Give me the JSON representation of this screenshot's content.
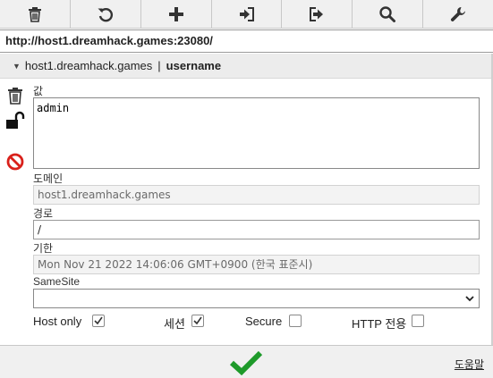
{
  "toolbar": {
    "buttons": [
      {
        "icon": "trash-icon",
        "label": "delete"
      },
      {
        "icon": "undo-icon",
        "label": "undo"
      },
      {
        "icon": "plus-icon",
        "label": "add"
      },
      {
        "icon": "import-icon",
        "label": "import"
      },
      {
        "icon": "export-icon",
        "label": "export"
      },
      {
        "icon": "search-icon",
        "label": "search"
      },
      {
        "icon": "wrench-icon",
        "label": "options"
      }
    ]
  },
  "url": "http://host1.dreamhack.games:23080/",
  "cookie": {
    "domain": "host1.dreamhack.games",
    "separator": "|",
    "name": "username"
  },
  "side_icons": [
    "trash-icon",
    "unlock-icon",
    "block-icon"
  ],
  "form": {
    "value_label": "값",
    "value": "admin",
    "domain_label": "도메인",
    "domain": "host1.dreamhack.games",
    "path_label": "경로",
    "path": "/",
    "expiry_label": "기한",
    "expiry": "Mon Nov 21 2022 14:06:06 GMT+0900 (한국 표준시)",
    "samesite_label": "SameSite",
    "samesite": ""
  },
  "checkboxes": {
    "host_only": {
      "label": "Host only",
      "checked": true
    },
    "session": {
      "label": "세션",
      "checked": true
    },
    "secure": {
      "label": "Secure",
      "checked": false
    },
    "http_only": {
      "label": "HTTP 전용",
      "checked": false
    }
  },
  "bottom": {
    "help": "도움말"
  },
  "colors": {
    "accent_green": "#1e9a2a",
    "block_red": "#d9211b"
  }
}
